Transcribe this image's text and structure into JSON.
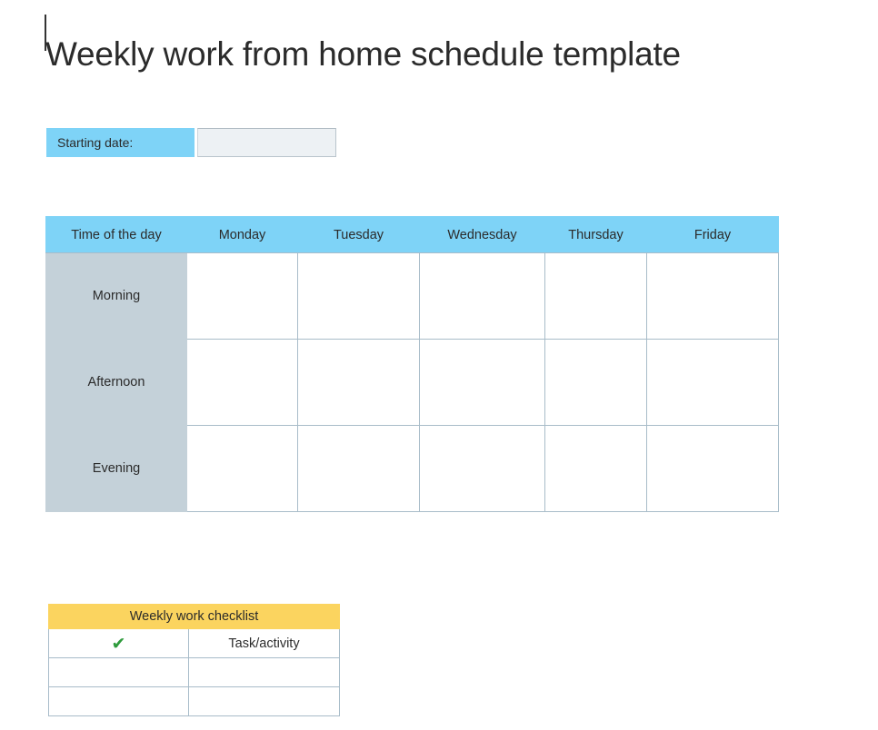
{
  "document": {
    "title": "Weekly work from home schedule template"
  },
  "starting_date": {
    "label": "Starting date:",
    "value": "",
    "placeholder": ""
  },
  "schedule": {
    "headers": [
      "Time of the day",
      "Monday",
      "Tuesday",
      "Wednesday",
      "Thursday",
      "Friday"
    ],
    "rows": [
      {
        "label": "Morning",
        "cells": [
          "",
          "",
          "",
          "",
          ""
        ]
      },
      {
        "label": "Afternoon",
        "cells": [
          "",
          "",
          "",
          "",
          ""
        ]
      },
      {
        "label": "Evening",
        "cells": [
          "",
          "",
          "",
          "",
          ""
        ]
      }
    ]
  },
  "checklist": {
    "title": "Weekly work checklist",
    "header_check_icon": "check-mark-icon",
    "header_check_glyph": "✔",
    "header_task_label": "Task/activity",
    "rows": [
      {
        "done": "",
        "task": ""
      },
      {
        "done": "",
        "task": ""
      }
    ]
  },
  "colors": {
    "header_blue": "#7ED3F7",
    "row_label_gray": "#C4D1D9",
    "checklist_yellow": "#FBD45F",
    "border": "#A8BCC9",
    "check_green": "#2E9B3C",
    "input_field": "#EDF1F4"
  }
}
